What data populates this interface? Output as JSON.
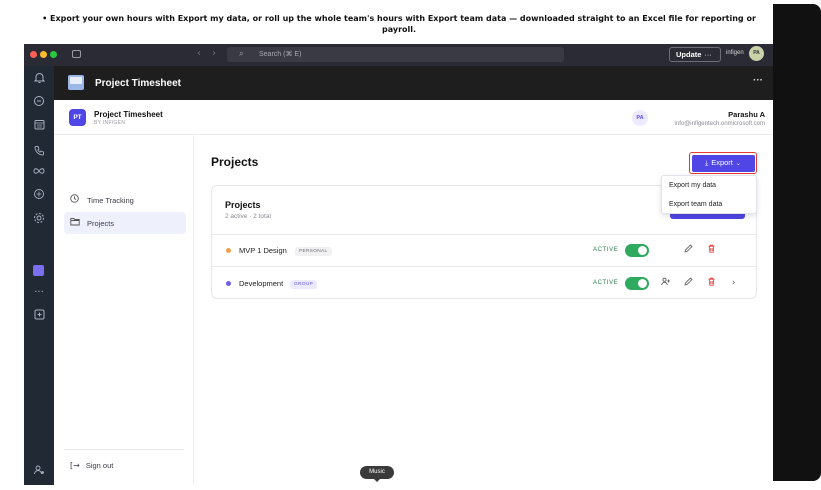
{
  "caption": "• Export your own hours with Export my data, or roll up the whole team's hours with Export team data — downloaded straight to an Excel file for reporting or payroll.",
  "titlebar": {
    "search_placeholder": "Search (⌘ E)",
    "update_label": "Update",
    "update_more": "···",
    "org_name": "infigen",
    "org_avatar": "PA"
  },
  "rail": {
    "icons": [
      "bell-icon",
      "chat-icon",
      "calendar-icon",
      "phone-icon",
      "infinity-icon",
      "openai-icon",
      "settings-icon",
      "app-square-icon",
      "more-icon",
      "add-icon",
      "people-icon"
    ],
    "more_label": "···",
    "add_label": "+"
  },
  "app_header": {
    "title": "Project Timesheet",
    "more": "···"
  },
  "subheader": {
    "badge": "PT",
    "title": "Project Timesheet",
    "by": "BY INFIGEN",
    "user_initials": "PA",
    "user_name": "Parashu A",
    "user_email": "info@infigentech.onmicrosoft.com"
  },
  "sidenav": {
    "items": [
      {
        "label": "Time Tracking",
        "icon": "clock-icon"
      },
      {
        "label": "Projects",
        "icon": "folder-icon"
      }
    ],
    "signout_label": "Sign out"
  },
  "main": {
    "title": "Projects",
    "export_label": "Export",
    "card_title": "Projects",
    "card_sub": "2 active · 2 total",
    "projects": [
      {
        "name": "MVP 1 Design",
        "tag": "PERSONAL",
        "status": "ACTIVE",
        "dot_color": "#f0a04b",
        "tag_bg": "#f1f1f4",
        "tag_color": "#6b6b75"
      },
      {
        "name": "Development",
        "tag": "GROUP",
        "status": "ACTIVE",
        "dot_color": "#6d5df0",
        "tag_bg": "#ecebfd",
        "tag_color": "#5b50e6"
      }
    ]
  },
  "dropdown": {
    "options": [
      "Export my data",
      "Export team data"
    ]
  },
  "music_label": "Music",
  "colors": {
    "accent": "#4f46e5",
    "highlight": "#e53935",
    "toggle_on": "#2faa5f",
    "delete": "#e53935"
  }
}
